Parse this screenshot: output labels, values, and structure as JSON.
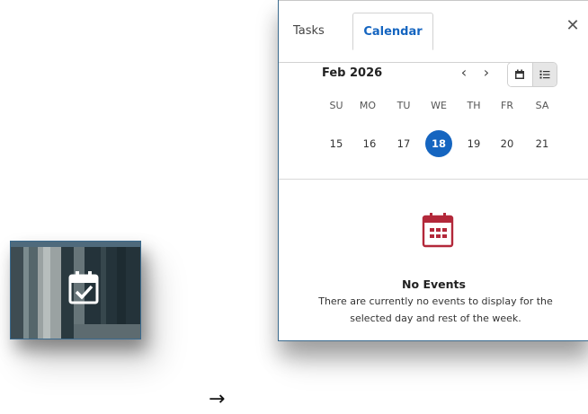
{
  "thumbnail": {
    "icon": "calendar-check-icon"
  },
  "arrow": {
    "glyph": "→"
  },
  "panel": {
    "tabs": [
      {
        "label": "Tasks",
        "active": false
      },
      {
        "label": "Calendar",
        "active": true
      }
    ],
    "close_glyph": "✕",
    "month_label": "Feb 2026",
    "prev_glyph": "‹",
    "next_glyph": "›",
    "view_modes": [
      {
        "icon": "calendar-view-icon",
        "active": false
      },
      {
        "icon": "list-view-icon",
        "active": true
      }
    ],
    "weekdays": [
      "SU",
      "MO",
      "TU",
      "WE",
      "TH",
      "FR",
      "SA"
    ],
    "days": [
      {
        "num": "15",
        "selected": false
      },
      {
        "num": "16",
        "selected": false
      },
      {
        "num": "17",
        "selected": false
      },
      {
        "num": "18",
        "selected": true
      },
      {
        "num": "19",
        "selected": false
      },
      {
        "num": "20",
        "selected": false
      },
      {
        "num": "21",
        "selected": false
      }
    ],
    "empty_state": {
      "icon": "calendar-grid-icon",
      "title": "No Events",
      "message": "There are currently no events to display for the selected day and rest of the week."
    }
  },
  "colors": {
    "accent": "#1565c0",
    "empty_icon": "#b3283a",
    "border": "#3a6a8e"
  }
}
